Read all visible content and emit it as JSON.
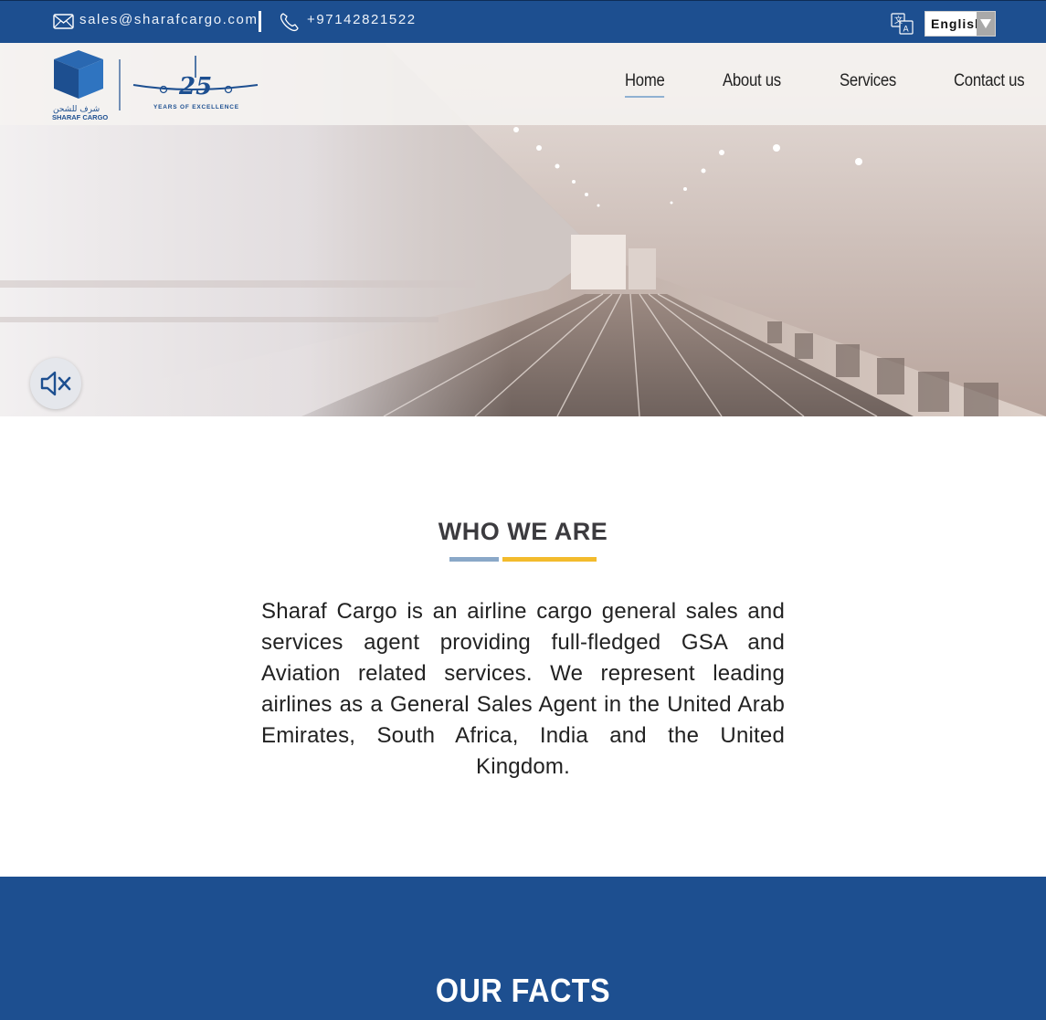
{
  "topbar": {
    "email": "sales@sharafcargo.com",
    "phone": "+97142821522",
    "language": "English"
  },
  "logo": {
    "arabic_name": "شرف للشحن",
    "brand_name": "SHARAF CARGO",
    "anniversary_number": "25",
    "anniversary_text": "YEARS OF EXCELLENCE"
  },
  "nav": {
    "items": [
      {
        "label": "Home",
        "active": true
      },
      {
        "label": "About us",
        "active": false
      },
      {
        "label": "Services",
        "active": false
      },
      {
        "label": "Contact us",
        "active": false
      }
    ]
  },
  "who_we_are": {
    "title": "WHO WE ARE",
    "body": "Sharaf Cargo is an airline cargo general sales and services agent providing full-fledged GSA and Aviation related services. We represent leading airlines as a General Sales Agent in the United Arab Emirates, South Africa, India and the United Kingdom."
  },
  "facts": {
    "title": "OUR FACTS"
  },
  "colors": {
    "brand_blue": "#1d4f90",
    "accent_yellow": "#f3bb2c",
    "accent_light_blue": "#8aa8c8"
  },
  "icons": [
    "mail-icon",
    "phone-icon",
    "translate-icon",
    "chevron-down-icon",
    "mute-icon"
  ]
}
